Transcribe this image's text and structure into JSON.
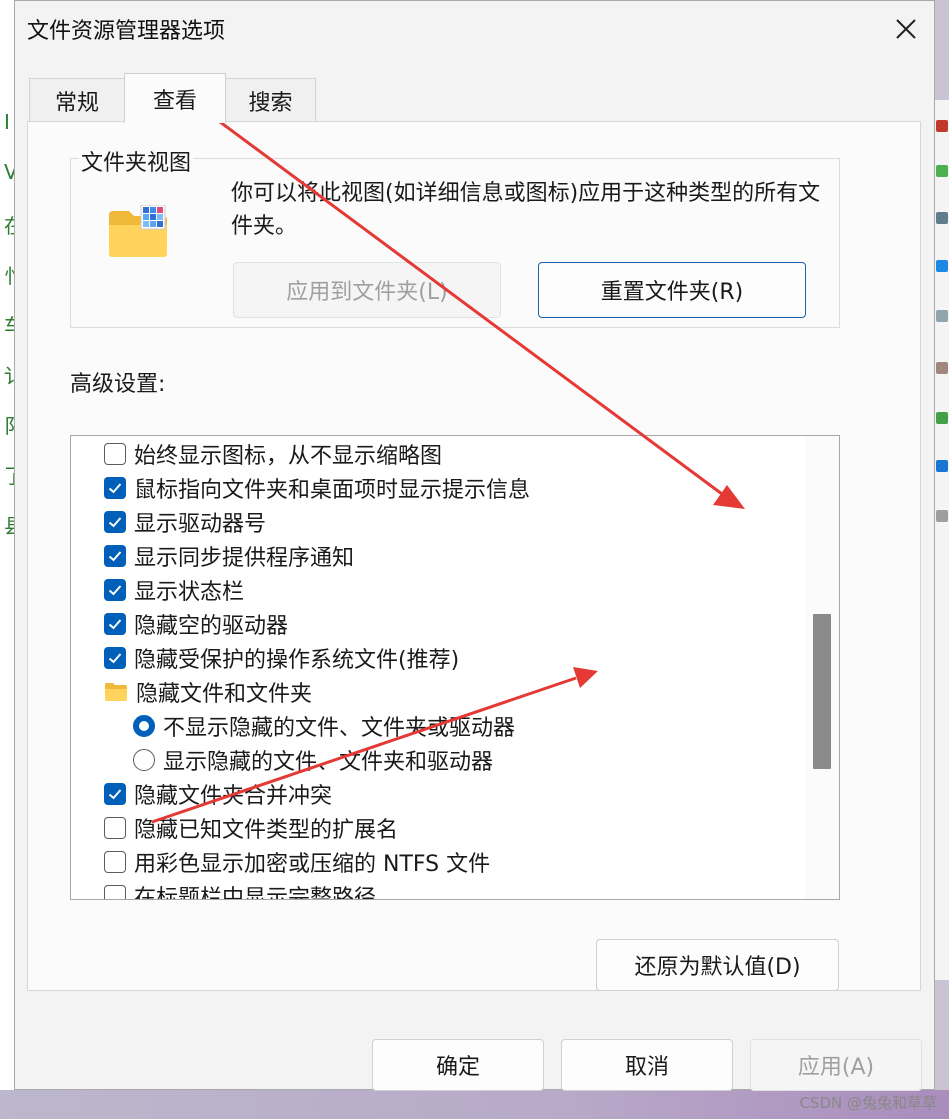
{
  "window": {
    "title": "文件资源管理器选项",
    "close_label": "✕"
  },
  "tabs": [
    {
      "label": "常规",
      "active": false
    },
    {
      "label": "查看",
      "active": true
    },
    {
      "label": "搜索",
      "active": false
    }
  ],
  "folder_view": {
    "group_title": "文件夹视图",
    "description": "你可以将此视图(如详细信息或图标)应用于这种类型的所有文件夹。",
    "apply_button": "应用到文件夹(L)",
    "reset_button": "重置文件夹(R)"
  },
  "advanced": {
    "label": "高级设置:",
    "items": [
      {
        "type": "checkbox",
        "label": "始终显示图标，从不显示缩略图",
        "checked": false
      },
      {
        "type": "checkbox",
        "label": "鼠标指向文件夹和桌面项时显示提示信息",
        "checked": true
      },
      {
        "type": "checkbox",
        "label": "显示驱动器号",
        "checked": true
      },
      {
        "type": "checkbox",
        "label": "显示同步提供程序通知",
        "checked": true
      },
      {
        "type": "checkbox",
        "label": "显示状态栏",
        "checked": true
      },
      {
        "type": "checkbox",
        "label": "隐藏空的驱动器",
        "checked": true
      },
      {
        "type": "checkbox",
        "label": "隐藏受保护的操作系统文件(推荐)",
        "checked": true
      },
      {
        "type": "folder",
        "label": "隐藏文件和文件夹"
      },
      {
        "type": "radio",
        "label": "不显示隐藏的文件、文件夹或驱动器",
        "checked": true
      },
      {
        "type": "radio",
        "label": "显示隐藏的文件、文件夹和驱动器",
        "checked": false
      },
      {
        "type": "checkbox",
        "label": "隐藏文件夹合并冲突",
        "checked": true
      },
      {
        "type": "checkbox",
        "label": "隐藏已知文件类型的扩展名",
        "checked": false
      },
      {
        "type": "checkbox",
        "label": "用彩色显示加密或压缩的 NTFS 文件",
        "checked": false
      },
      {
        "type": "checkbox",
        "label": "在标题栏中显示完整路径",
        "checked": false
      }
    ]
  },
  "restore_button": "还原为默认值(D)",
  "footer": {
    "ok": "确定",
    "cancel": "取消",
    "apply": "应用(A)"
  },
  "watermark": "CSDN @兔兔和草草",
  "colors": {
    "accent": "#005fb8",
    "arrow": "#e53935"
  }
}
